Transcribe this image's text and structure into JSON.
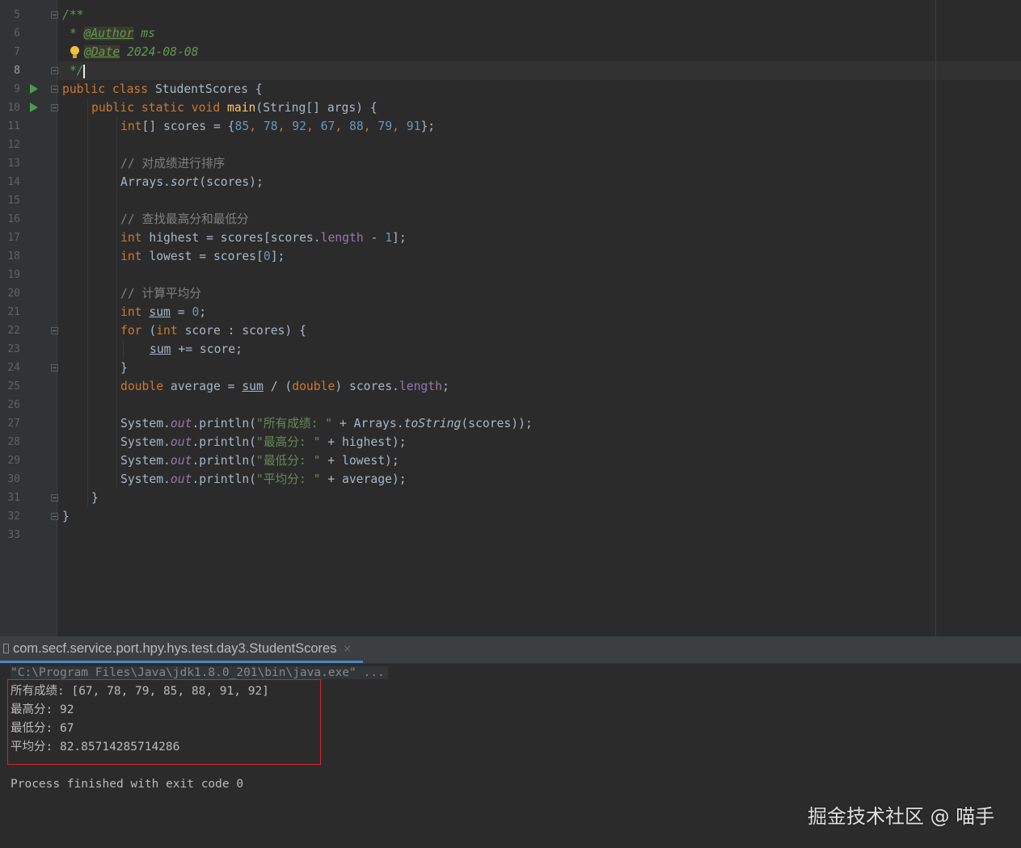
{
  "editor": {
    "line_numbers": [
      "5",
      "6",
      "7",
      "8",
      "9",
      "10",
      "11",
      "12",
      "13",
      "14",
      "15",
      "16",
      "17",
      "18",
      "19",
      "20",
      "21",
      "22",
      "23",
      "24",
      "25",
      "26",
      "27",
      "28",
      "29",
      "30",
      "31",
      "32",
      "33"
    ],
    "doc_open": "/**",
    "author_prefix": " * ",
    "author_tag": "@Author",
    "author_value": " ms",
    "date_tag": "@Date",
    "date_value": " 2024-08-08",
    "doc_close": " */",
    "code": {
      "l9": [
        "public class ",
        "StudentScores {"
      ],
      "l10": [
        "public static void ",
        "main",
        "(String[] args) {"
      ],
      "l11": [
        "int",
        "[] scores = {",
        "85",
        ", ",
        "78",
        ", ",
        "92",
        ", ",
        "67",
        ", ",
        "88",
        ", ",
        "79",
        ", ",
        "91",
        "};"
      ],
      "l13": "// 对成绩进行排序",
      "l14": [
        "Arrays.",
        "sort",
        "(scores);"
      ],
      "l16": "// 查找最高分和最低分",
      "l17": [
        "int ",
        "highest = scores[scores.",
        "length",
        " - ",
        "1",
        "];"
      ],
      "l18": [
        "int ",
        "lowest = scores[",
        "0",
        "];"
      ],
      "l20": "// 计算平均分",
      "l21": [
        "int ",
        "sum",
        " = ",
        "0",
        ";"
      ],
      "l22": [
        "for ",
        "(",
        "int ",
        "score : scores) {"
      ],
      "l23": [
        "sum",
        " += score;"
      ],
      "l24": "}",
      "l25": [
        "double ",
        "average = ",
        "sum",
        " / (",
        "double",
        ") scores.",
        "length",
        ";"
      ],
      "l27": [
        "System.",
        "out",
        ".println(",
        "\"所有成绩: \"",
        " + Arrays.",
        "toString",
        "(scores));"
      ],
      "l28": [
        "System.",
        "out",
        ".println(",
        "\"最高分: \"",
        " + highest);"
      ],
      "l29": [
        "System.",
        "out",
        ".println(",
        "\"最低分: \"",
        " + lowest);"
      ],
      "l30": [
        "System.",
        "out",
        ".println(",
        "\"平均分: \"",
        " + average);"
      ],
      "l31": "}",
      "l32": "}"
    }
  },
  "run_panel": {
    "tab_label": "com.secf.service.port.hpy.hys.test.day3.StudentScores",
    "close_glyph": "×",
    "command": "\"C:\\Program Files\\Java\\jdk1.8.0_201\\bin\\java.exe\" ...",
    "output": [
      "所有成绩: [67, 78, 79, 85, 88, 91, 92]",
      "最高分: 92",
      "最低分: 67",
      "平均分: 82.85714285714286"
    ],
    "exit_message": "Process finished with exit code 0"
  },
  "watermark": "掘金技术社区 @ 喵手",
  "colors": {
    "background": "#2b2b2b",
    "keyword": "#cc7832",
    "number": "#6897bb",
    "string": "#6a8759",
    "comment": "#808080",
    "method": "#ffc66d",
    "field": "#9876aa",
    "highlight_box": "#d2262a"
  },
  "icons": [
    "run-gutter-icon",
    "fold-icon",
    "intention-bulb-icon",
    "console-tab-icon",
    "close-icon"
  ]
}
